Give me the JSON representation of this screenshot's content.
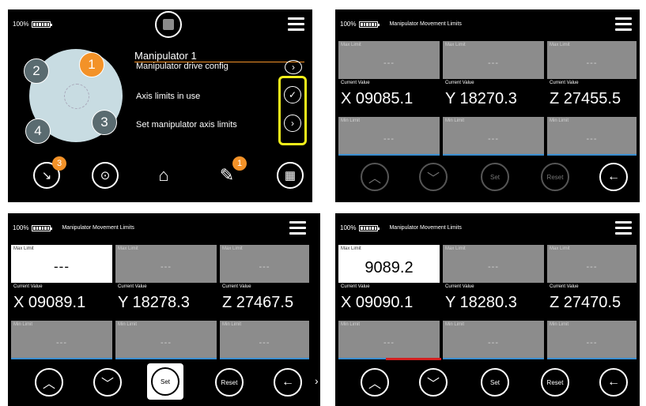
{
  "status": {
    "battery": "100%"
  },
  "panel1": {
    "manipulator_title": "Manipulator 1",
    "menu": [
      {
        "label": "Manipulator drive config",
        "icon": "chevron-right-icon"
      },
      {
        "label": "Axis limits in use",
        "icon": "check-icon"
      },
      {
        "label": "Set manipulator axis limits",
        "icon": "chevron-right-icon"
      }
    ],
    "manipulators": [
      "1",
      "2",
      "3",
      "4"
    ],
    "active_manipulator": "1",
    "nav_badges": {
      "gauge": "3",
      "remote": "1"
    },
    "colors": {
      "accent": "#f39228",
      "highlight": "#f2ef1a",
      "disc": "#c8dce2"
    }
  },
  "limits_screen": {
    "title": "Manipulator Movement Limits",
    "labels": {
      "max": "Max Limit",
      "current": "Current Value",
      "min": "Min Limit"
    },
    "empty": "---",
    "buttons": {
      "set": "Set",
      "reset": "Reset"
    }
  },
  "panel2": {
    "axes": [
      {
        "max": "---",
        "current": "X 09085.1",
        "min": "---"
      },
      {
        "max": "---",
        "current": "Y 18270.3",
        "min": "---"
      },
      {
        "max": "---",
        "current": "Z 27455.5",
        "min": "---"
      }
    ]
  },
  "panel3": {
    "axes": [
      {
        "max": "---",
        "current": "X 09089.1",
        "min": "---"
      },
      {
        "max": "---",
        "current": "Y 18278.3",
        "min": "---"
      },
      {
        "max": "---",
        "current": "Z 27467.5",
        "min": "---"
      }
    ]
  },
  "panel4": {
    "axes": [
      {
        "max": "9089.2",
        "current": "X 09090.1",
        "min": "---"
      },
      {
        "max": "---",
        "current": "Y 18280.3",
        "min": "---"
      },
      {
        "max": "---",
        "current": "Z 27470.5",
        "min": "---"
      }
    ]
  }
}
